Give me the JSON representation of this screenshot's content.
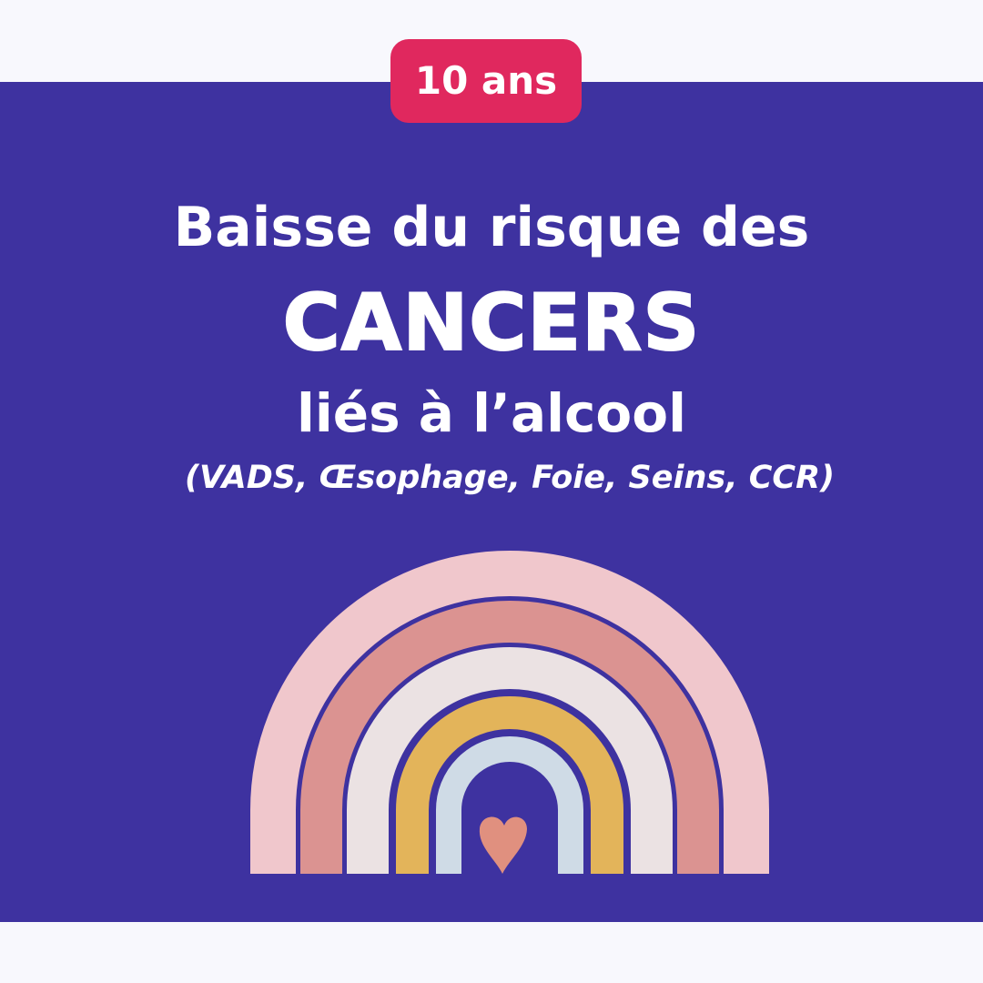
{
  "badge": {
    "label": "10 ans"
  },
  "headline": {
    "line1": "Baisse du risque des",
    "line2": "CANCERS",
    "line3": "liés à l’alcool",
    "line4": "(VADS, Œsophage, Foie, Seins, CCR)"
  },
  "colors": {
    "page_background": "#f8f8fd",
    "panel_background": "#3e32a0",
    "badge_background": "#e0285e",
    "text": "#ffffff",
    "rainbow_arcs": [
      "#f0c7cc",
      "#db9391",
      "#ebe2e3",
      "#e3b45a",
      "#cfdbe6"
    ],
    "heart": "#e0907f"
  },
  "illustration": {
    "rainbow_icon": "rainbow-icon",
    "heart_icon": "heart-icon"
  }
}
